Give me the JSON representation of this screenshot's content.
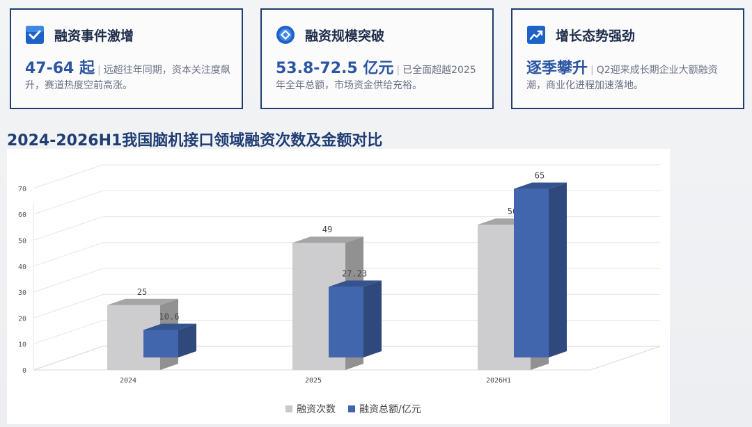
{
  "cards": [
    {
      "icon": "checkbox-icon",
      "title": "融资事件激增",
      "highlight": "47-64 起",
      "separator": "|",
      "text": "远超往年同期，资本关注度飙升，赛道热度空前高涨。"
    },
    {
      "icon": "target-icon",
      "title": "融资规模突破",
      "highlight": "53.8-72.5 亿元",
      "separator": "|",
      "text": "已全面超越2025年全年总额，市场资金供给充裕。"
    },
    {
      "icon": "trend-up-icon",
      "title": "增长态势强劲",
      "highlight": "逐季攀升",
      "separator": "|",
      "text": "Q2迎来成长期企业大额融资潮，商业化进程加速落地。"
    }
  ],
  "chart_title": "2024-2026H1我国脑机接口领域融资次数及金额对比",
  "colors": {
    "border": "#1f3d6e",
    "accent": "#2c56a3",
    "title": "#203d74",
    "grey_series": "#c9c9cb",
    "blue_series": "#4166ae"
  },
  "chart_data": {
    "type": "bar",
    "style": "3d-clustered",
    "categories": [
      "2024",
      "2025",
      "2026H1"
    ],
    "series": [
      {
        "name": "融资次数",
        "values": [
          25,
          49,
          56
        ],
        "labels": [
          "25",
          "49",
          "56"
        ],
        "color": "#c9c9cb"
      },
      {
        "name": "融资总额/亿元",
        "values": [
          10.6,
          27.23,
          65
        ],
        "labels": [
          "10.6",
          "27.23",
          "65"
        ],
        "color": "#4166ae"
      }
    ],
    "yticks": [
      0,
      10,
      20,
      30,
      40,
      50,
      60,
      70
    ],
    "ylim": [
      0,
      75
    ],
    "grid": true,
    "legend_position": "bottom"
  }
}
